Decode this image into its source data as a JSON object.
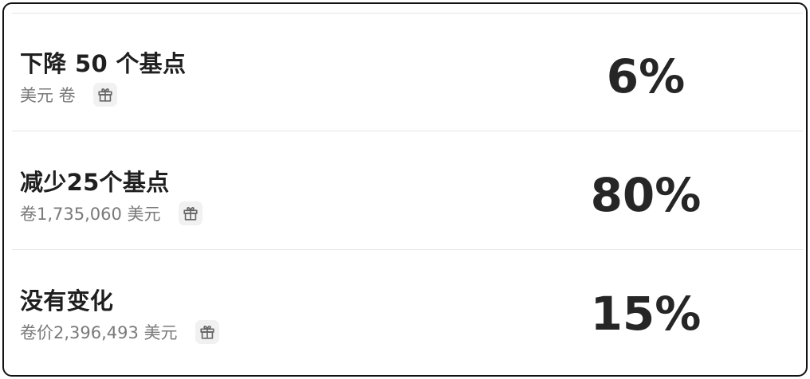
{
  "outcomes": [
    {
      "title": "下降 50 个基点",
      "volume": "美元 卷",
      "reward_icon": "gift-icon",
      "probability": "6%"
    },
    {
      "title": "减少25个基点",
      "volume": "卷1,735,060 美元",
      "reward_icon": "gift-icon",
      "probability": "80%"
    },
    {
      "title": "没有变化",
      "volume": "卷价2,396,493 美元",
      "reward_icon": "gift-icon",
      "probability": "15%"
    }
  ],
  "colors": {
    "border": "#111111",
    "divider": "#e6e6e6",
    "title_text": "#1f1f1f",
    "muted_text": "#7a7a7a",
    "percent_text": "#262626",
    "badge_bg": "#f1f1f1"
  }
}
